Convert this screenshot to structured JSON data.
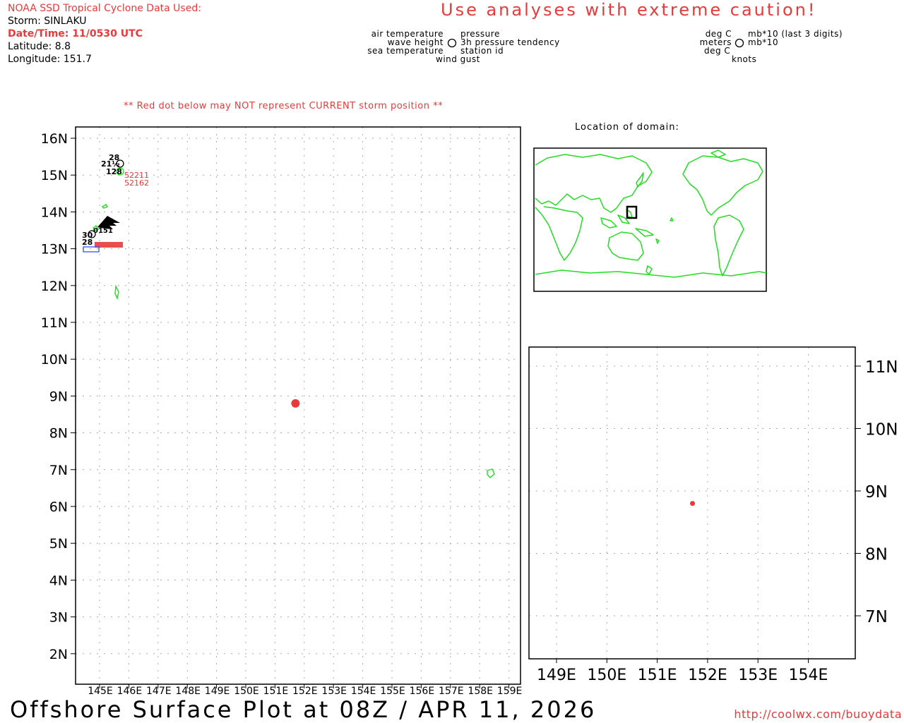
{
  "header": {
    "source": "NOAA SSD Tropical Cyclone Data Used:",
    "storm": "Storm: SINLAKU",
    "datetime": "Date/Time: 11/0530 UTC",
    "latitude": "Latitude: 8.8",
    "longitude": "Longitude: 151.7",
    "caution": "Use analyses with extreme caution!",
    "red_dot_note": "** Red dot below may NOT represent CURRENT storm position **"
  },
  "legend": {
    "left": {
      "air_temperature": "air temperature",
      "wave_height": "wave height",
      "sea_temperature": "sea temperature",
      "pressure": "pressure",
      "pressure_tendency": "3h pressure tendency",
      "station_id": "station id",
      "wind_gust": "wind gust"
    },
    "right": {
      "deg_c_top": "deg C",
      "meters": "meters",
      "deg_c_bottom": "deg C",
      "mb_last3": "mb*10 (last 3 digits)",
      "mb10": "mb*10",
      "knots": "knots"
    }
  },
  "inset": {
    "title": "Location of domain:"
  },
  "main_map": {
    "lat_labels": [
      "16N",
      "15N",
      "14N",
      "13N",
      "12N",
      "11N",
      "10N",
      "9N",
      "8N",
      "7N",
      "6N",
      "5N",
      "4N",
      "3N",
      "2N"
    ],
    "lon_labels": [
      "145E",
      "146E",
      "147E",
      "148E",
      "149E",
      "150E",
      "151E",
      "152E",
      "153E",
      "154E",
      "155E",
      "156E",
      "157E",
      "158E",
      "159E"
    ],
    "storm": {
      "lat": 8.8,
      "lon": 151.7,
      "color": "#e83a3a"
    },
    "stations": [
      {
        "text": "28"
      },
      {
        "text": "21½"
      },
      {
        "text": "128"
      },
      {
        "text": "52211"
      },
      {
        "text": "52162"
      },
      {
        "text": "30"
      },
      {
        "text": "28"
      },
      {
        "text": "0151"
      }
    ]
  },
  "zoom_map": {
    "lat_labels": [
      "11N",
      "10N",
      "9N",
      "8N",
      "7N"
    ],
    "lon_labels": [
      "149E",
      "150E",
      "151E",
      "152E",
      "153E",
      "154E"
    ]
  },
  "footer": {
    "title": "Offshore Surface Plot at 08Z / APR 11, 2026",
    "url": "http://coolwx.com/buoydata"
  },
  "colors": {
    "land": "#22dd22",
    "storm": "#e83a3a",
    "station_id": "#e83a3a",
    "buoy_blue": "#3355ee",
    "grid": "#aaaaaa"
  }
}
